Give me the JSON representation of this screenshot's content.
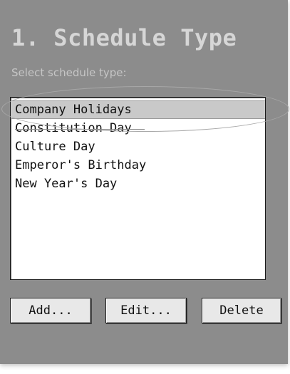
{
  "panel": {
    "title": "1. Schedule Type",
    "subtitle": "Select schedule type:"
  },
  "schedule_types": {
    "items": [
      {
        "label": "Company Holidays",
        "selected": true
      },
      {
        "label": "Constitution Day",
        "selected": false
      },
      {
        "label": "Culture Day",
        "selected": false
      },
      {
        "label": "Emperor's Birthday",
        "selected": false
      },
      {
        "label": "New Year's Day",
        "selected": false
      }
    ]
  },
  "buttons": {
    "add_label": "Add...",
    "edit_label": "Edit...",
    "delete_label": "Delete"
  },
  "colors": {
    "panel_bg": "#8c8c8c",
    "title_text": "#d6d6d6",
    "selection_bg": "#c9c9c9",
    "button_bg": "#e8e8e8"
  }
}
